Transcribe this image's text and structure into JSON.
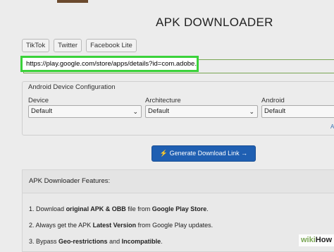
{
  "header": {
    "title": "APK DOWNLOADER"
  },
  "quick_links": [
    "TikTok",
    "Twitter",
    "Facebook Lite"
  ],
  "url_input": {
    "value": "https://play.google.com/store/apps/details?id=com.adobe.psmobile"
  },
  "config": {
    "title": "Android Device Configuration",
    "fields": [
      {
        "label": "Device",
        "value": "Default"
      },
      {
        "label": "Architecture",
        "value": "Default"
      },
      {
        "label": "Android",
        "value": "Default"
      }
    ],
    "stub": "A"
  },
  "generate_button": {
    "icon": "bolt-icon",
    "label": "Generate Download Link →"
  },
  "features": {
    "title": "APK Downloader Features:",
    "items": [
      {
        "n": "1.",
        "pre": "Download ",
        "b1": "original APK & OBB",
        "mid": " file from ",
        "b2": "Google Play Store",
        "post": "."
      },
      {
        "n": "2.",
        "pre": "Always get the APK ",
        "b1": "Latest Version",
        "mid": " from Google Play updates.",
        "b2": "",
        "post": ""
      },
      {
        "n": "3.",
        "pre": "Bypass ",
        "b1": "Geo-restrictions",
        "mid": " and ",
        "b2": "Incompatible",
        "post": "."
      }
    ]
  },
  "watermark": {
    "wiki": "wiki",
    "how": "How"
  }
}
